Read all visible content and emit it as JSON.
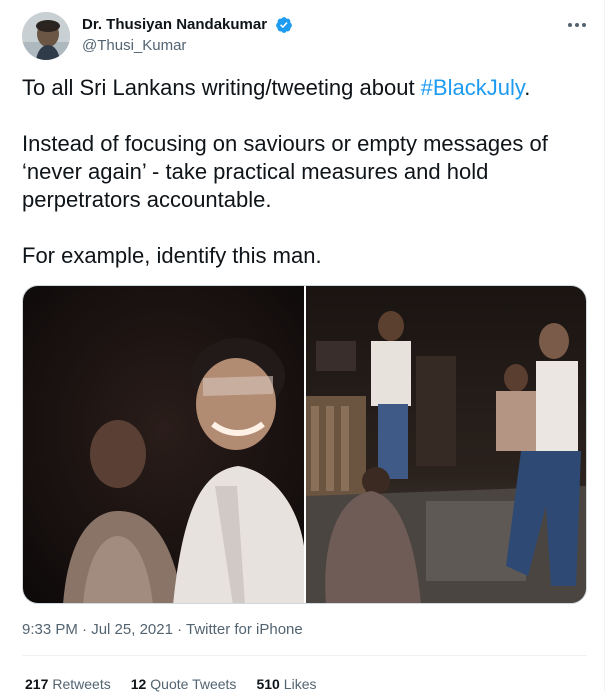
{
  "author": {
    "display_name": "Dr. Thusiyan Nandakumar",
    "handle": "@Thusi_Kumar",
    "verified": true
  },
  "icons": {
    "verified": "verified-badge-icon",
    "more": "more-options-icon"
  },
  "colors": {
    "link": "#1d9bf0",
    "text": "#0f1419",
    "muted": "#536471",
    "border": "#eff3f4"
  },
  "tweet": {
    "line1_before": "To all Sri Lankans writing/tweeting about ",
    "hashtag": "#BlackJuly",
    "line1_after": ".",
    "paragraph2": "Instead of focusing on saviours or empty messages of ‘never again’ - take practical measures and hold perpetrators accountable.",
    "paragraph3": "For example, identify this man."
  },
  "meta": {
    "time": "9:33 PM",
    "separator1": " · ",
    "date": "Jul 25, 2021",
    "separator2": " · ",
    "source": "Twitter for iPhone"
  },
  "stats": {
    "retweets_count": "217",
    "retweets_label": "Retweets",
    "quotes_count": "12",
    "quotes_label": "Quote Tweets",
    "likes_count": "510",
    "likes_label": "Likes"
  }
}
